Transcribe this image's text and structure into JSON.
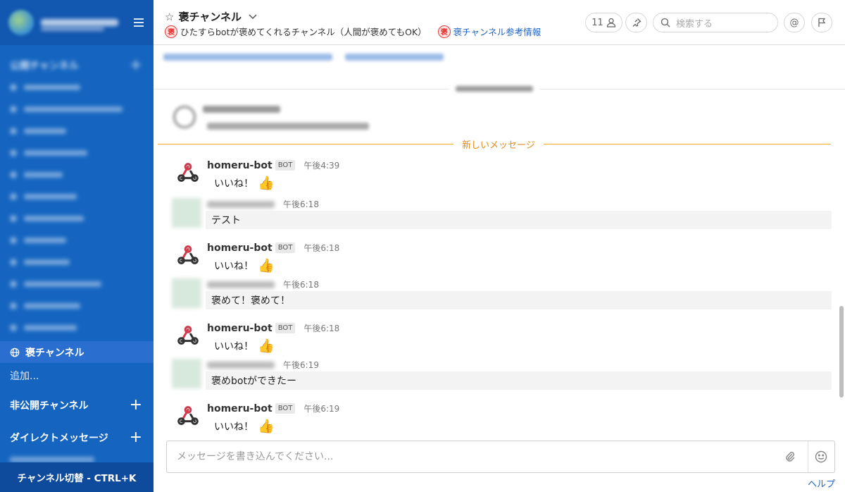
{
  "sidebar": {
    "public_header": "公開チャンネル",
    "active_channel": "褒チャンネル",
    "add_more": "追加...",
    "private_header": "非公開チャンネル",
    "dm_header": "ダイレクトメッセージ",
    "switcher": "チャンネル切替 - CTRL+K"
  },
  "header": {
    "channel_name": "褒チャンネル",
    "badge": "褒",
    "purpose": "ひたすらbotが褒めてくれるチャンネル（人間が褒めてもOK）",
    "reference_link": "褒チャンネル参考情報",
    "member_count": "11",
    "search_placeholder": "検索する"
  },
  "messages": {
    "new_divider": "新しいメッセージ",
    "items": [
      {
        "user": "homeru-bot",
        "bot_tag": "BOT",
        "time": "午後4:39",
        "text": "いいね！"
      },
      {
        "user": "",
        "time": "午後6:18",
        "text": "テスト"
      },
      {
        "user": "homeru-bot",
        "bot_tag": "BOT",
        "time": "午後6:18",
        "text": "いいね！"
      },
      {
        "user": "",
        "time": "午後6:18",
        "text": "褒めて！褒めて！"
      },
      {
        "user": "homeru-bot",
        "bot_tag": "BOT",
        "time": "午後6:18",
        "text": "いいね！"
      },
      {
        "user": "",
        "time": "午後6:19",
        "text": "褒めbotができたー"
      },
      {
        "user": "homeru-bot",
        "bot_tag": "BOT",
        "time": "午後6:19",
        "text": "いいね！"
      }
    ]
  },
  "input": {
    "placeholder": "メッセージを書き込んでください..."
  },
  "footer": {
    "help": "ヘルプ"
  },
  "icons": {
    "thumbs_up_color": "#f1b81c",
    "accent": "#1565c0"
  }
}
